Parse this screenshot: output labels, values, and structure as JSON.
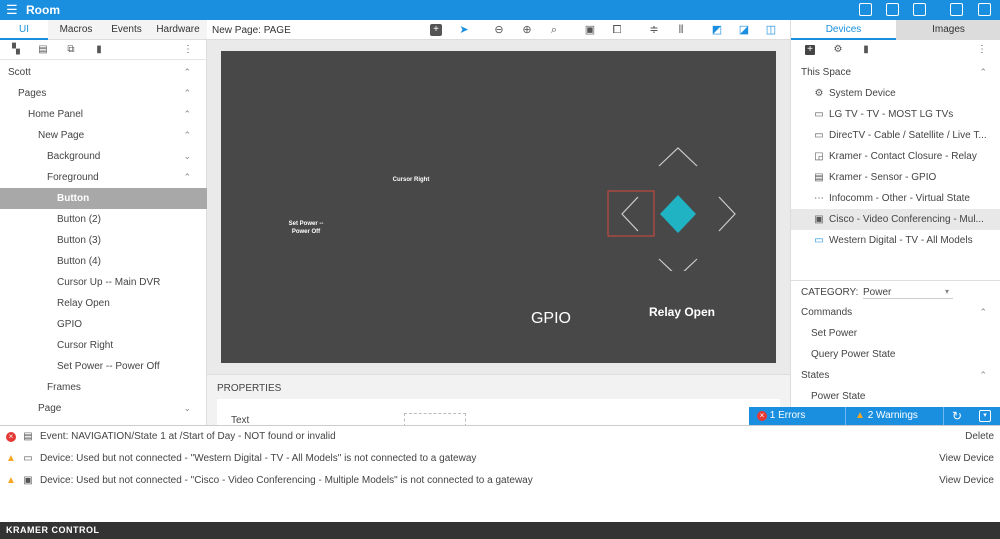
{
  "app": {
    "title": "Room",
    "menu_icon": "menu-icon"
  },
  "left_panel": {
    "tabs": [
      {
        "label": "UI"
      },
      {
        "label": "Macros"
      },
      {
        "label": "Events"
      },
      {
        "label": "Hardware"
      }
    ],
    "tree": [
      {
        "label": "Scott",
        "chev": "⌃"
      },
      {
        "label": "Pages",
        "chev": "⌃"
      },
      {
        "label": "Home Panel",
        "chev": "⌃"
      },
      {
        "label": "New Page",
        "chev": "⌃"
      },
      {
        "label": "Background",
        "chev": "⌄"
      },
      {
        "label": "Foreground",
        "chev": "⌃"
      },
      {
        "label": "Button",
        "chev": ""
      },
      {
        "label": "Button (2)",
        "chev": ""
      },
      {
        "label": "Button (3)",
        "chev": ""
      },
      {
        "label": "Button (4)",
        "chev": ""
      },
      {
        "label": "Cursor Up -- Main DVR",
        "chev": ""
      },
      {
        "label": "Relay Open",
        "chev": ""
      },
      {
        "label": "GPIO",
        "chev": ""
      },
      {
        "label": "Cursor Right",
        "chev": ""
      },
      {
        "label": "Set Power -- Power Off",
        "chev": ""
      },
      {
        "label": "Frames",
        "chev": ""
      },
      {
        "label": "Page",
        "chev": "⌄"
      }
    ]
  },
  "center": {
    "page_name": "New Page: PAGE",
    "canvas": {
      "cursor_right": "Cursor Right",
      "set_power": "Set Power --",
      "set_power_2": "Power Off",
      "gpio": "GPIO",
      "relay_open": "Relay Open"
    },
    "properties": {
      "header": "PROPERTIES",
      "first_field": "Text"
    }
  },
  "right_panel": {
    "tabs": [
      {
        "label": "Devices"
      },
      {
        "label": "Images"
      }
    ],
    "this_space": "This Space",
    "devices": [
      {
        "label": "System Device",
        "icon": "gear-icon"
      },
      {
        "label": "LG TV - TV - MOST LG TVs",
        "icon": "monitor-icon"
      },
      {
        "label": "DirecTV - Cable / Satellite / Live T...",
        "icon": "monitor-icon"
      },
      {
        "label": "Kramer - Contact Closure - Relay",
        "icon": "relay-icon"
      },
      {
        "label": "Kramer - Sensor - GPIO",
        "icon": "gpio-icon"
      },
      {
        "label": "Infocomm - Other - Virtual State",
        "icon": "virtual-icon"
      },
      {
        "label": "Cisco - Video Conferencing - Mul...",
        "icon": "video-icon"
      },
      {
        "label": "Western Digital - TV - All Models",
        "icon": "monitor-icon"
      }
    ],
    "category_label": "CATEGORY:",
    "category_value": "Power",
    "commands_header": "Commands",
    "commands": [
      {
        "label": "Set Power"
      },
      {
        "label": "Query Power State"
      }
    ],
    "states_header": "States",
    "states": [
      {
        "label": "Power State"
      }
    ]
  },
  "status": {
    "errors": "1 Errors",
    "warnings": "2 Warnings"
  },
  "log": [
    {
      "level": "error",
      "message": "Event: NAVIGATION/State 1 at /Start of Day - NOT found or invalid",
      "action": "Delete"
    },
    {
      "level": "warning",
      "message": "Device: Used but not connected - \"Western Digital - TV - All Models\" is not connected to a gateway",
      "action": "View Device"
    },
    {
      "level": "warning",
      "message": "Device: Used but not connected - \"Cisco - Video Conferencing - Multiple Models\" is not connected to a gateway",
      "action": "View Device"
    }
  ],
  "footer": {
    "brand": "KRAMER CONTROL"
  },
  "colors": {
    "accent": "#1a8fe0",
    "canvas": "#484848",
    "diamond": "#1fb3c4",
    "error": "#e53935",
    "warning": "#f5a623"
  }
}
